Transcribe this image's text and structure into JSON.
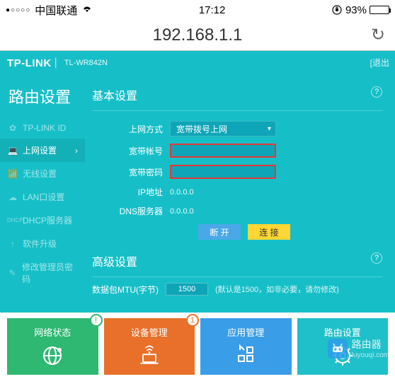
{
  "status_bar": {
    "signal_dots": "●○○○○",
    "carrier": "中国联通",
    "time": "17:12",
    "battery_pct": "93%"
  },
  "address_bar": {
    "url": "192.168.1.1"
  },
  "router": {
    "brand": "TP-LINK",
    "model": "TL-WR842N",
    "logout": "[退出",
    "sidebar_title": "路由设置",
    "sidebar": [
      {
        "icon": "✿",
        "label": "TP-LINK ID"
      },
      {
        "icon": "💻",
        "label": "上网设置",
        "active": true
      },
      {
        "icon": "📶",
        "label": "无线设置"
      },
      {
        "icon": "☁",
        "label": "LAN口设置"
      },
      {
        "icon": "DHCP",
        "label": "DHCP服务器"
      },
      {
        "icon": "↑",
        "label": "软件升级"
      },
      {
        "icon": "✎",
        "label": "修改管理员密码"
      }
    ],
    "basic_section": "基本设置",
    "advanced_section": "高级设置",
    "form": {
      "conn_type_label": "上网方式",
      "conn_type_value": "宽带拨号上网",
      "username_label": "宽带帐号",
      "username_value": "",
      "password_label": "宽带密码",
      "password_value": "",
      "ip_label": "IP地址",
      "ip_value": "0.0.0.0",
      "dns_label": "DNS服务器",
      "dns_value": "0.0.0.0",
      "disconnect_btn": "断 开",
      "connect_btn": "连 接"
    },
    "mtu": {
      "label": "数据包MTU(字节)",
      "value": "1500",
      "hint": "(默认是1500，如非必要，请勿修改)"
    }
  },
  "tabs": [
    {
      "label": "网络状态",
      "badge": "!"
    },
    {
      "label": "设备管理",
      "badge": "1"
    },
    {
      "label": "应用管理"
    },
    {
      "label": "路由设置"
    }
  ],
  "watermark": {
    "name": "路由器",
    "site": "luyouqi.com"
  }
}
